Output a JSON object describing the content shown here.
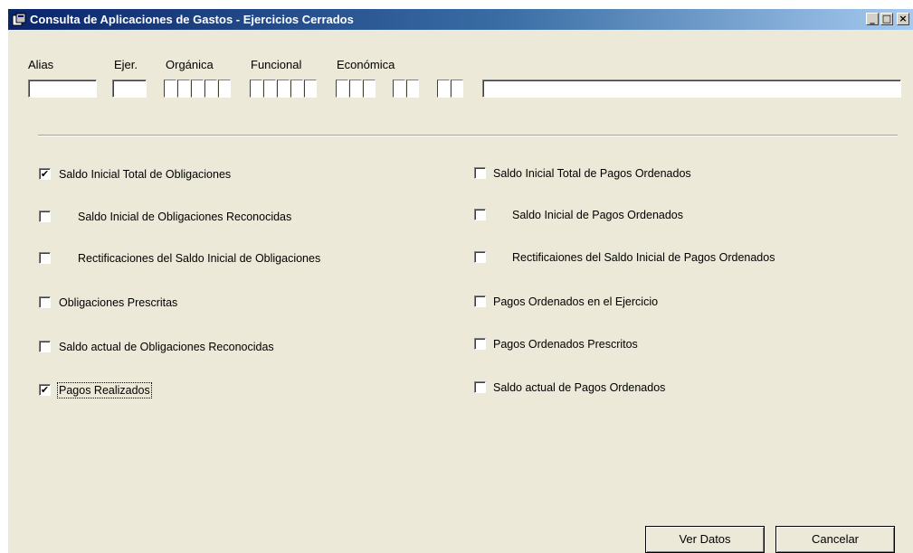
{
  "window": {
    "title": "Consulta de Aplicaciones de Gastos - Ejercicios Cerrados",
    "min_label": "_",
    "max_label": "□",
    "close_label": "×"
  },
  "filters": {
    "alias_label": "Alias",
    "ejer_label": "Ejer.",
    "organica_label": "Orgánica",
    "funcional_label": "Funcional",
    "economica_label": "Económica",
    "alias_value": "",
    "ejer_value": "",
    "description_value": ""
  },
  "options_left": [
    {
      "label": "Saldo Inicial Total de Obligaciones",
      "checked": true,
      "mark": "✔"
    },
    {
      "label": "Saldo Inicial de Obligaciones Reconocidas",
      "checked": false,
      "mark": ""
    },
    {
      "label": "Rectificaciones del Saldo Inicial de Obligaciones",
      "checked": false,
      "mark": ""
    },
    {
      "label": "Obligaciones Prescritas",
      "checked": false,
      "mark": ""
    },
    {
      "label": "Saldo actual de Obligaciones Reconocidas",
      "checked": false,
      "mark": ""
    },
    {
      "label": "Pagos Realizados",
      "checked": true,
      "mark": "✔"
    }
  ],
  "options_right": [
    {
      "label": "Saldo Inicial Total de Pagos Ordenados",
      "checked": false
    },
    {
      "label": "Saldo  Inicial de Pagos Ordenados",
      "checked": false
    },
    {
      "label": "Rectificaiones del Saldo Inicial de Pagos Ordenados",
      "checked": false
    },
    {
      "label": "Pagos Ordenados en el Ejercicio",
      "checked": false
    },
    {
      "label": "Pagos Ordenados Prescritos",
      "checked": false
    },
    {
      "label": "Saldo actual de Pagos Ordenados",
      "checked": false
    }
  ],
  "buttons": {
    "ver_datos": "Ver Datos",
    "cancelar": "Cancelar"
  }
}
